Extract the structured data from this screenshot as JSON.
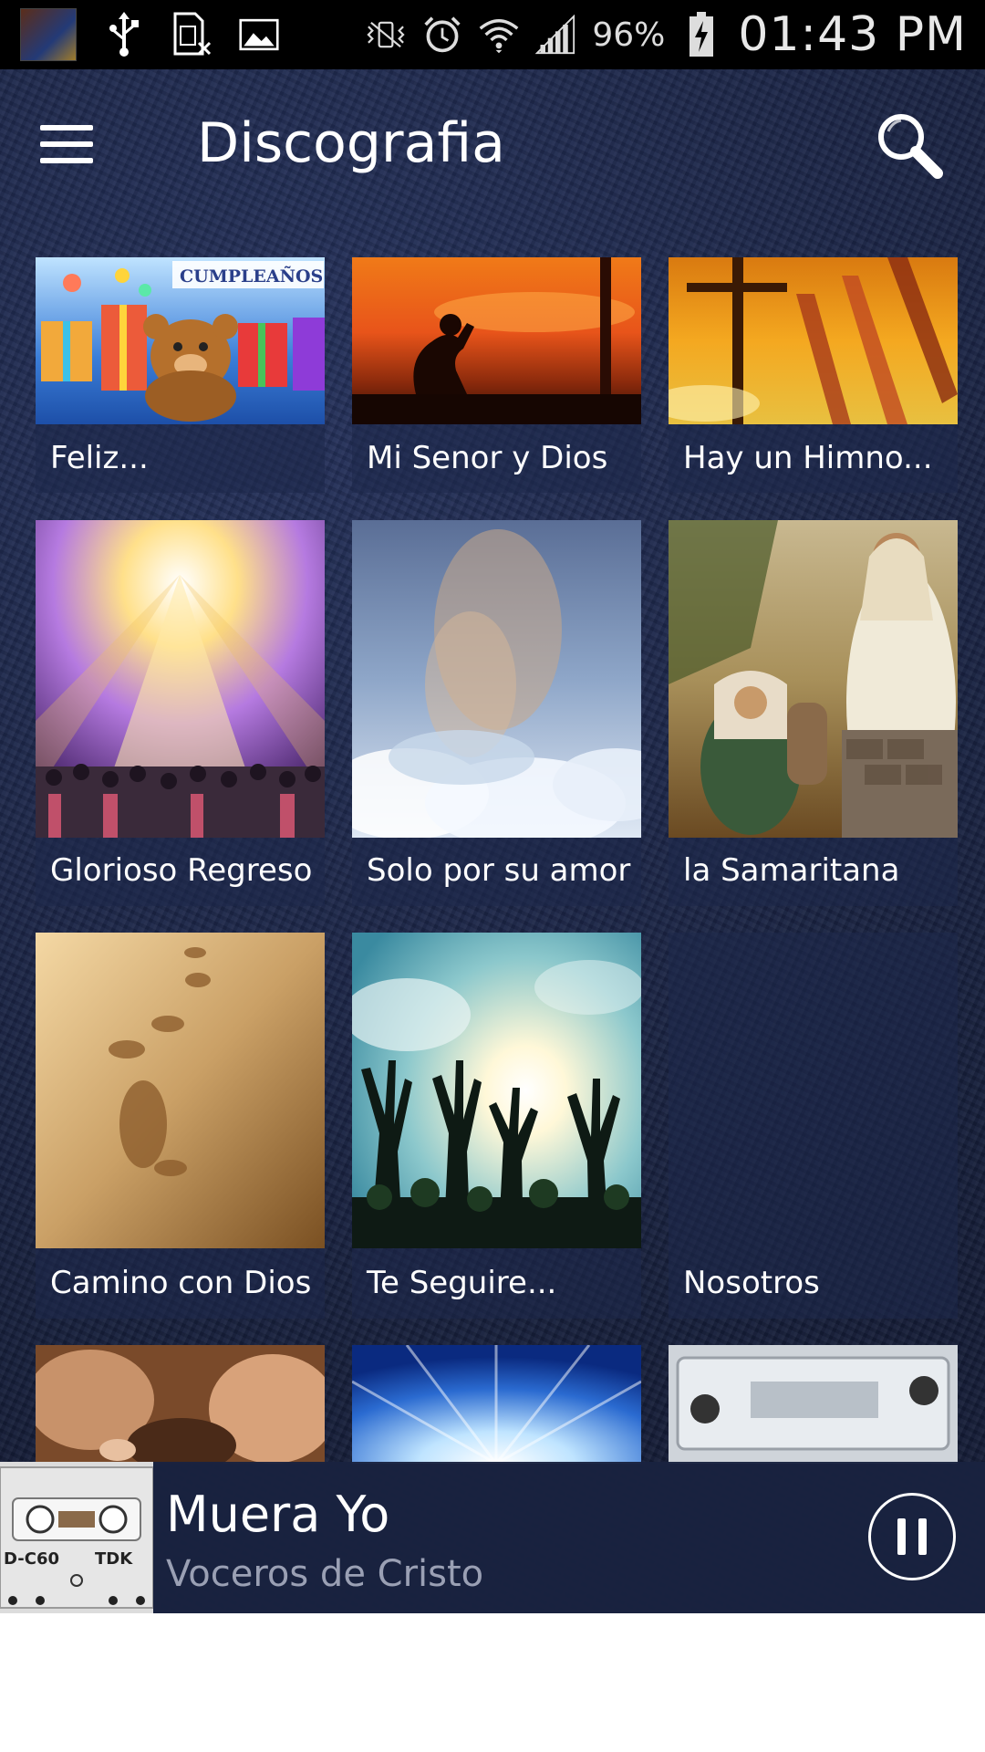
{
  "status_bar": {
    "battery": "96%",
    "time": "01:43 PM",
    "icons": [
      "album-thumbnail-icon",
      "usb-icon",
      "sim-card-icon",
      "image-icon",
      "vibrate-icon",
      "alarm-icon",
      "wifi-icon",
      "signal-icon",
      "battery-charging-icon"
    ]
  },
  "toolbar": {
    "title": "Discografia",
    "menu_icon": "hamburger-menu-icon",
    "search_icon": "search-icon"
  },
  "albums": [
    {
      "title": "Feliz..."
    },
    {
      "title": "Mi Senor y Dios"
    },
    {
      "title": "Hay un Himno..."
    },
    {
      "title": "Glorioso Regreso"
    },
    {
      "title": "Solo por su amor"
    },
    {
      "title": "la Samaritana"
    },
    {
      "title": "Camino con Dios"
    },
    {
      "title": "Te Seguire..."
    },
    {
      "title": "Nosotros"
    }
  ],
  "album_art_text": {
    "birthday": "CUMPLEAÑOS"
  },
  "player": {
    "title": "Muera Yo",
    "artist": "Voceros de Cristo",
    "control_icon": "pause-icon",
    "cassette_label_left": "D-C60",
    "cassette_label_right": "TDK"
  },
  "colors": {
    "background": "#1b2544",
    "text": "#ffffff",
    "artist_text": "#9aa0b4"
  }
}
